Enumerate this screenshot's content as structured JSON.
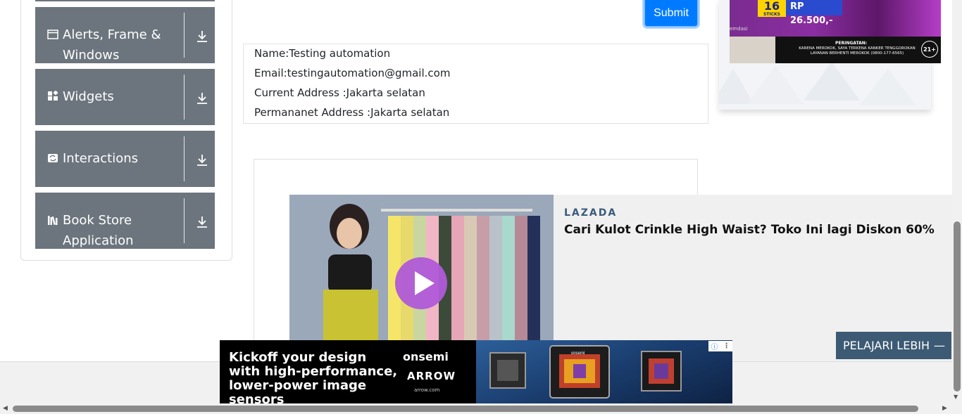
{
  "sidebar": {
    "groups": [
      {
        "label": "Alerts, Frame & Windows",
        "icon": "window-icon"
      },
      {
        "label": "Widgets",
        "icon": "widgets-icon"
      },
      {
        "label": "Interactions",
        "icon": "interactions-icon"
      },
      {
        "label": "Book Store Application",
        "icon": "book-store-icon"
      }
    ]
  },
  "form": {
    "submit_label": "Submit"
  },
  "output": {
    "name": "Name:Testing automation",
    "email": "Email:testingautomation@gmail.com",
    "current_address": "Current Address :Jakarta selatan",
    "permanent_address": "Permananet Address :Jakarta selatan"
  },
  "top_ad": {
    "sticks_number": "16",
    "sticks_label": "STICKS",
    "price": "RP 26.500,-",
    "fragment": "emdasi",
    "warning_title": "PERINGATAN:",
    "warning_text": "KARENA MEROKOK, SAYA TERKENA KANKER TENGGOROKAN LAYANAN BERHENTI MEROKOK (0800-177-6565)",
    "age": "21+"
  },
  "lazada_ad": {
    "brand": "LAZADA",
    "headline": "Cari Kulot Crinkle High Waist? Toko Ini lagi Diskon 60%",
    "cta": "PELAJARI LEBIH"
  },
  "bottom_ad": {
    "message": "Kickoff your design with high-performance, lower-power image sensors",
    "brand1": "onsemi",
    "brand2": "ARROW",
    "url": "arrow.com",
    "chip_label": "onsemi"
  },
  "colors": {
    "sidebar_group": "#6c757d",
    "submit": "#007bff",
    "lazada_brand": "#3b5b7a",
    "cta_bg": "#3c5a73",
    "play_button": "#b05ad8"
  }
}
